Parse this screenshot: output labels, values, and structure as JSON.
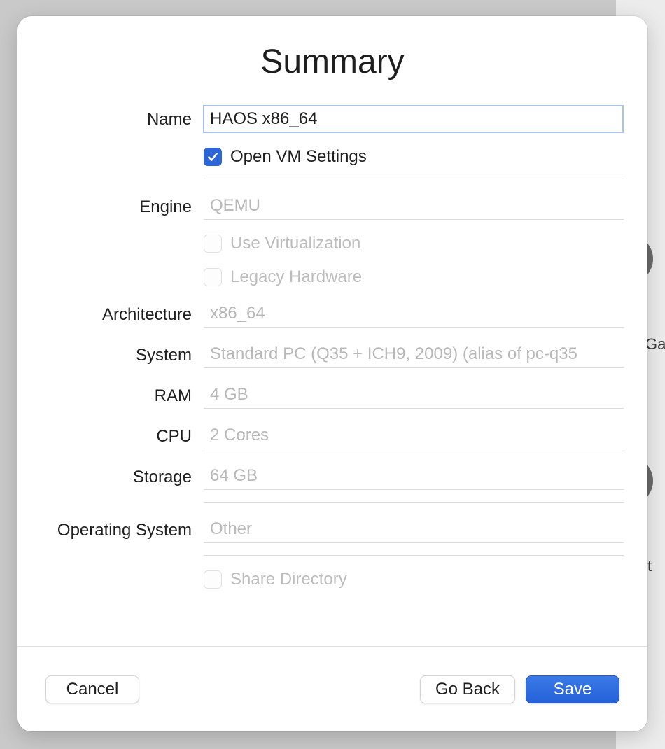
{
  "background": {
    "partial_label_1": "Ga",
    "partial_label_2": "t"
  },
  "dialog": {
    "title": "Summary"
  },
  "fields": {
    "name_label": "Name",
    "name_value": "HAOS x86_64",
    "open_vm_settings_label": "Open VM Settings",
    "open_vm_settings_checked": true,
    "engine_label": "Engine",
    "engine_value": "QEMU",
    "use_virtualization_label": "Use Virtualization",
    "legacy_hardware_label": "Legacy Hardware",
    "architecture_label": "Architecture",
    "architecture_value": "x86_64",
    "system_label": "System",
    "system_value": "Standard PC (Q35 + ICH9, 2009) (alias of pc-q35",
    "ram_label": "RAM",
    "ram_value": "4 GB",
    "cpu_label": "CPU",
    "cpu_value": "2 Cores",
    "storage_label": "Storage",
    "storage_value": "64 GB",
    "os_label": "Operating System",
    "os_value": "Other",
    "share_directory_label": "Share Directory"
  },
  "buttons": {
    "cancel": "Cancel",
    "go_back": "Go Back",
    "save": "Save"
  },
  "colors": {
    "accent": "#2d66d9",
    "disabled_text": "#b9b9b9"
  }
}
